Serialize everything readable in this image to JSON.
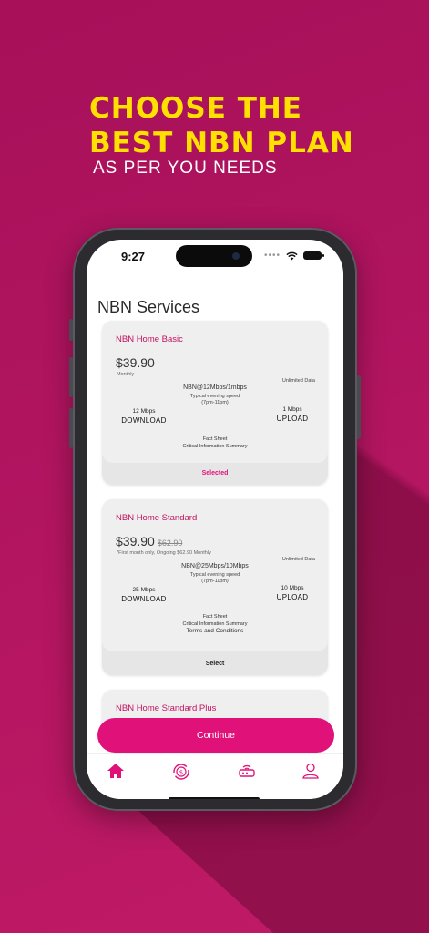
{
  "headline": {
    "line1": "CHOOSE THE",
    "line2": "BEST NBN PLAN",
    "line3": "AS PER YOU NEEDS"
  },
  "status_bar": {
    "time": "9:27",
    "dots": "••••"
  },
  "page": {
    "title": "NBN Services"
  },
  "plans": [
    {
      "name": "NBN Home Basic",
      "price": "$39.90",
      "old_price": "",
      "note": "Monthly",
      "data": "Unlimited Data",
      "speed_tier": "NBN@12Mbps/1mbps",
      "evening_label": "Typical evening speed",
      "evening_hours": "(7pm-11pm)",
      "download_value": "12 Mbps",
      "download_label": "DOWNLOAD",
      "upload_value": "1 Mbps",
      "upload_label": "UPLOAD",
      "fact_sheet": "Fact Sheet",
      "cis": "Critical Information Summary",
      "terms": "",
      "action": "Selected"
    },
    {
      "name": "NBN Home Standard",
      "price": "$39.90",
      "old_price": "$62.90",
      "note": "*First month only, Ongoing $62.90 Monthly",
      "data": "Unlimited Data",
      "speed_tier": "NBN@25Mbps/10Mbps",
      "evening_label": "Typical evening speed",
      "evening_hours": "(7pm-11pm)",
      "download_value": "25 Mbps",
      "download_label": "DOWNLOAD",
      "upload_value": "10 Mbps",
      "upload_label": "UPLOAD",
      "fact_sheet": "Fact Sheet",
      "cis": "Critical Information Summary",
      "terms": "Terms and Conditions",
      "action": "Select"
    },
    {
      "name": "NBN Home Standard Plus"
    }
  ],
  "continue_label": "Continue",
  "tabs": [
    {
      "icon": "home-icon",
      "active": true
    },
    {
      "icon": "dollar-refresh-icon",
      "active": false
    },
    {
      "icon": "router-icon",
      "active": false
    },
    {
      "icon": "user-icon",
      "active": false
    }
  ],
  "colors": {
    "brand": "#e0127a",
    "headline_yellow": "#ffe000",
    "background": "#b0145f",
    "plan_name": "#c2125f"
  }
}
